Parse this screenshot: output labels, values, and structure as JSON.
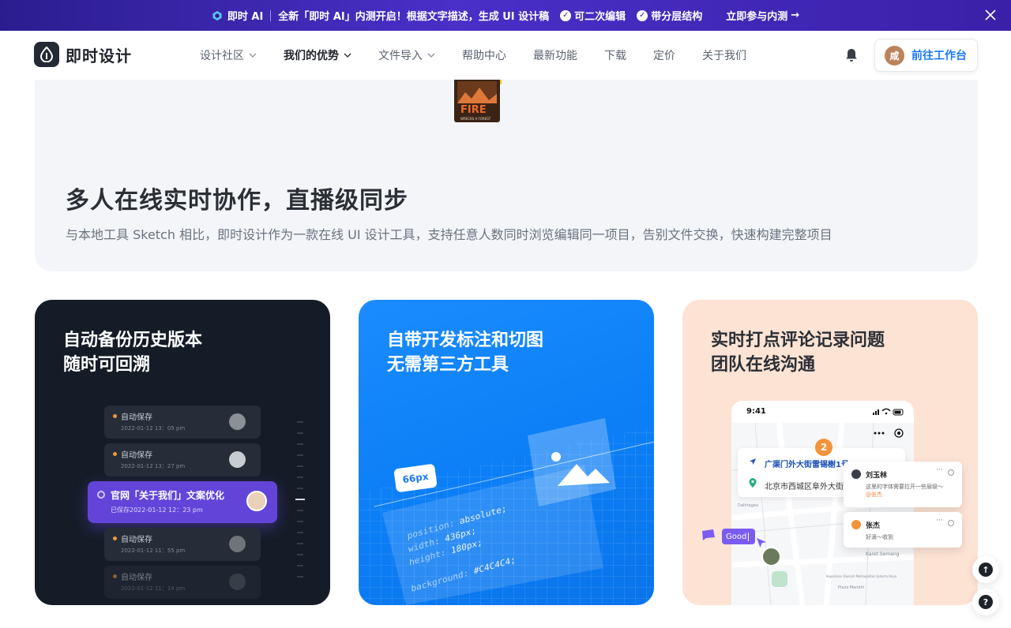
{
  "promo": {
    "brand": "即时 AI",
    "headline": "全新「即时 AI」内测开启！根据文字描述，生成 UI 设计稿",
    "feature_1": "可二次编辑",
    "feature_2": "带分层结构",
    "cta": "立即参与内测",
    "cta_arrow": "→",
    "check_glyph": "✓"
  },
  "nav": {
    "logo_text": "即时设计",
    "menu": [
      {
        "label": "设计社区"
      },
      {
        "label": "我们的优势"
      },
      {
        "label": "文件导入"
      },
      {
        "label": "帮助中心"
      },
      {
        "label": "最新功能"
      },
      {
        "label": "下载"
      },
      {
        "label": "定价"
      },
      {
        "label": "关于我们"
      }
    ],
    "avatar_initial": "咸",
    "workspace_label": "前往工作台"
  },
  "hero": {
    "title": "多人在线实时协作，直播级同步",
    "description": "与本地工具 Sketch 相比，即时设计作为一款在线 UI 设计工具，支持任意人数同时浏览编辑同一项目，告别文件交换，快速构建完整项目",
    "thumb_word": "FIRE",
    "thumb_caption": "WRECKS A FOREST"
  },
  "cards": {
    "history": {
      "title_line1": "自动备份历史版本",
      "title_line2": "随时可回溯",
      "items": [
        {
          "name": "自动保存",
          "time": "2022-01-12 13：05 pm"
        },
        {
          "name": "自动保存",
          "time": "2022-01-12 13：27 pm"
        },
        {
          "name": "自动保存",
          "time": "2022-01-12 11：55 pm"
        },
        {
          "name": "自动保存",
          "time": "2022-01-12 11：14 pm"
        }
      ],
      "active": {
        "name": "官网「关于我们」文案优化",
        "time": "已保存2022-01-12 12：23 pm"
      }
    },
    "dev": {
      "title_line1": "自带开发标注和切图",
      "title_line2": "无需第三方工具",
      "px_tag": "66px",
      "css": [
        {
          "k": "position:",
          "v": "absolute;"
        },
        {
          "k": "width:",
          "v": "436px;"
        },
        {
          "k": "height:",
          "v": "180px;"
        },
        {
          "k": "",
          "v": ""
        },
        {
          "k": "background:",
          "v": "#C4C4C4;"
        }
      ]
    },
    "comment": {
      "title_line1": "实时打点评论记录问题",
      "title_line2": "团队在线沟通",
      "phone_time": "9:41",
      "address_1": "广渠门外大街雷锡榭1号",
      "address_2": "北京市西城区阜外大街",
      "pin_number": "2",
      "comments": [
        {
          "author": "刘玉林",
          "body": "这里的字体需要拉开一些层级～",
          "mention": "@张杰",
          "more": "···"
        },
        {
          "author": "张杰",
          "body": "好滴～收到",
          "mention": "",
          "more": "···"
        }
      ],
      "typing_tag": "Good",
      "map_labels": [
        "Karet Semang",
        "Dahlragea",
        "Kepolisian Daerah Metropolitan Jakarta Raya",
        "Plaza Mandiri"
      ]
    }
  },
  "floating": {
    "top_label": "↑",
    "help_label": "?"
  },
  "colors": {
    "accent": "#1a7af8",
    "history_card_bg": "#151c27",
    "dev_card_bg": "#0b7df5",
    "comment_card_bg": "#fde3d4",
    "active_history": "#6245d8"
  }
}
